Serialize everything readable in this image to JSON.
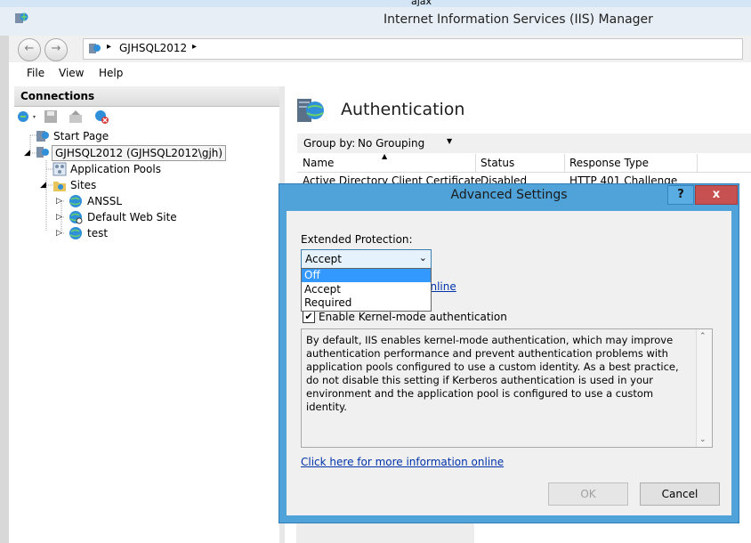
{
  "window": {
    "title": "Internet Information Services (IIS) Manager",
    "top_toolbar_text": "ajax"
  },
  "address": {
    "path_root_arrow": "▸",
    "server": "GJHSQL2012",
    "trail_arrow": "▸"
  },
  "menu": {
    "file": "File",
    "view": "View",
    "help": "Help"
  },
  "connections": {
    "header": "Connections",
    "tree": {
      "start_page": "Start Page",
      "server": "GJHSQL2012 (GJHSQL2012\\gjh)",
      "app_pools": "Application Pools",
      "sites": "Sites",
      "site1": "ANSSL",
      "site2": "Default Web Site",
      "site3": "test"
    }
  },
  "auth": {
    "title": "Authentication",
    "group_by_label": "Group by:",
    "group_by_value": "No Grouping",
    "columns": {
      "name": "Name",
      "status": "Status",
      "response_type": "Response Type"
    },
    "row": {
      "name": "Active Directory Client Certificate",
      "status": "Disabled",
      "response_type": "HTTP 401 Challenge"
    }
  },
  "dialog": {
    "title": "Advanced Settings",
    "help": "?",
    "close": "x",
    "extended_protection_label": "Extended Protection:",
    "selected": "Accept",
    "options": [
      "Off",
      "Accept",
      "Required"
    ],
    "link_partial": "ation online",
    "kernel_label": "Enable Kernel-mode authentication",
    "kernel_checked": true,
    "description": "By default, IIS enables kernel-mode authentication, which may improve authentication performance and prevent authentication problems with application pools configured to use a custom identity. As a best practice, do not disable this setting if Kerberos authentication is used in your environment and the application pool is configured to use a custom identity.",
    "more_info_link": "Click here for more information online",
    "ok": "OK",
    "cancel": "Cancel"
  },
  "colors": {
    "dialog_frame": "#4fa3d9",
    "close_button": "#c75050",
    "selection": "#3399ff",
    "link": "#0033aa"
  }
}
